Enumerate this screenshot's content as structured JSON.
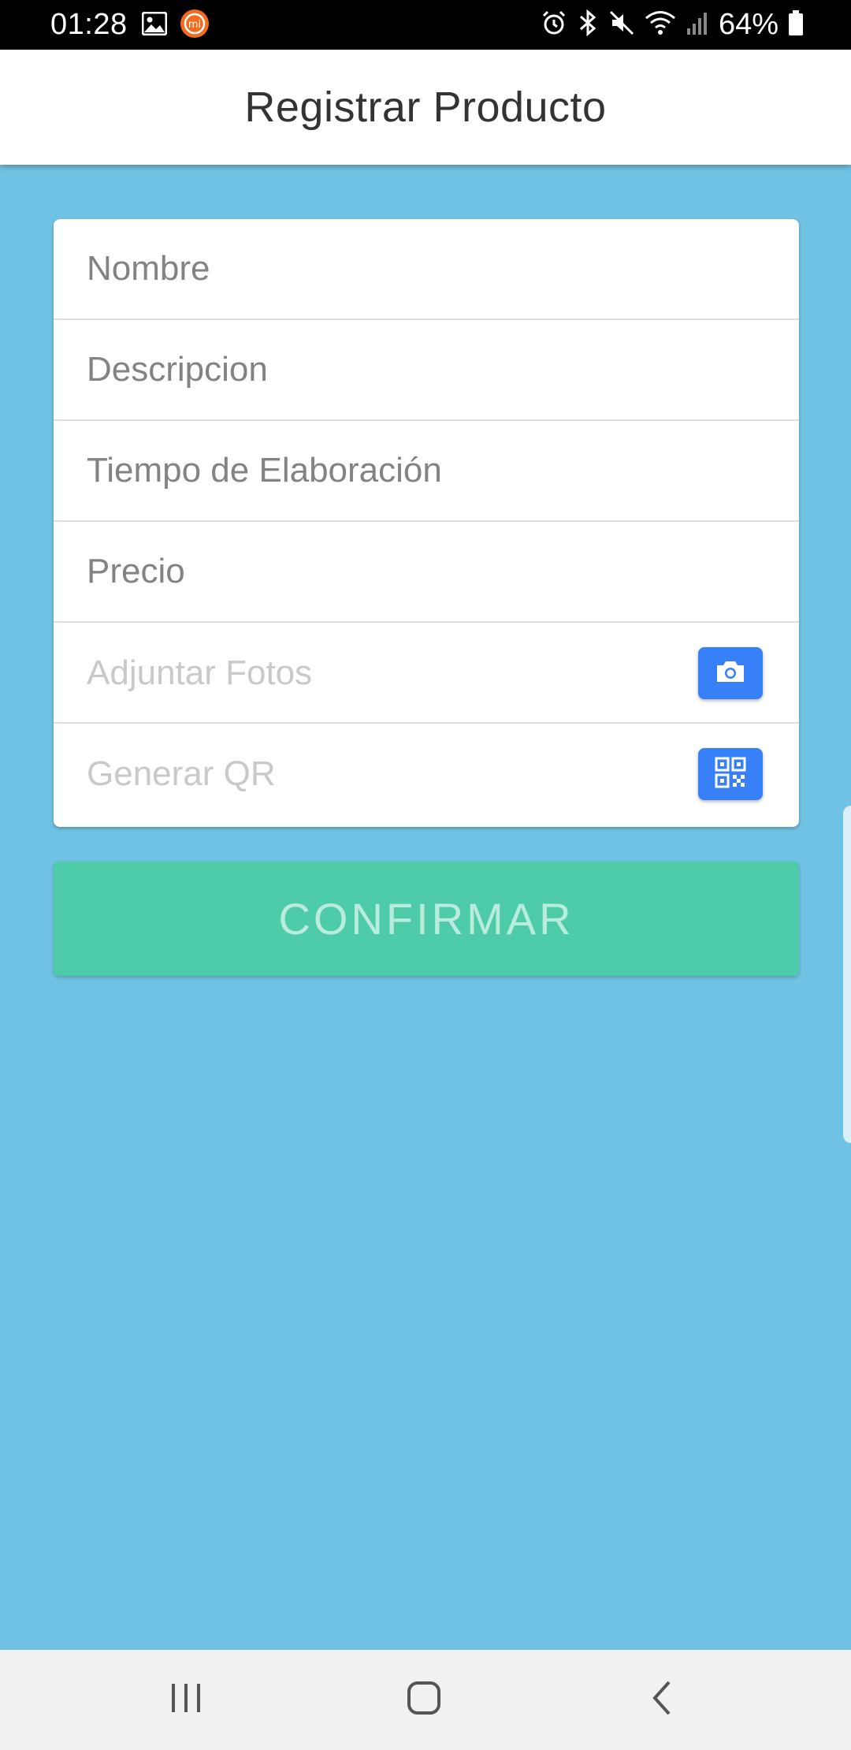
{
  "status_bar": {
    "time": "01:28",
    "battery_text": "64%",
    "left_icons": [
      "gallery-icon",
      "mi-app-icon"
    ],
    "right_icons": [
      "alarm-icon",
      "bluetooth-icon",
      "mute-icon",
      "wifi-icon",
      "cell-signal-icon",
      "battery-icon"
    ]
  },
  "header": {
    "title": "Registrar Producto"
  },
  "form": {
    "fields": [
      {
        "placeholder": "Nombre"
      },
      {
        "placeholder": "Descripcion"
      },
      {
        "placeholder": "Tiempo de Elaboración"
      },
      {
        "placeholder": "Precio"
      }
    ],
    "attach_photos_label": "Adjuntar Fotos",
    "attach_photos_icon": "camera-icon",
    "generate_qr_label": "Generar QR",
    "generate_qr_icon": "qr-code-icon"
  },
  "confirm_label": "CONFIRMAR",
  "colors": {
    "background": "#6fc2e3",
    "action_blue": "#3880f8",
    "confirm_green": "#4ecba8",
    "confirm_text": "#b9ebdf"
  },
  "nav_bar": {
    "buttons": [
      "recents-icon",
      "home-icon",
      "back-icon"
    ]
  }
}
